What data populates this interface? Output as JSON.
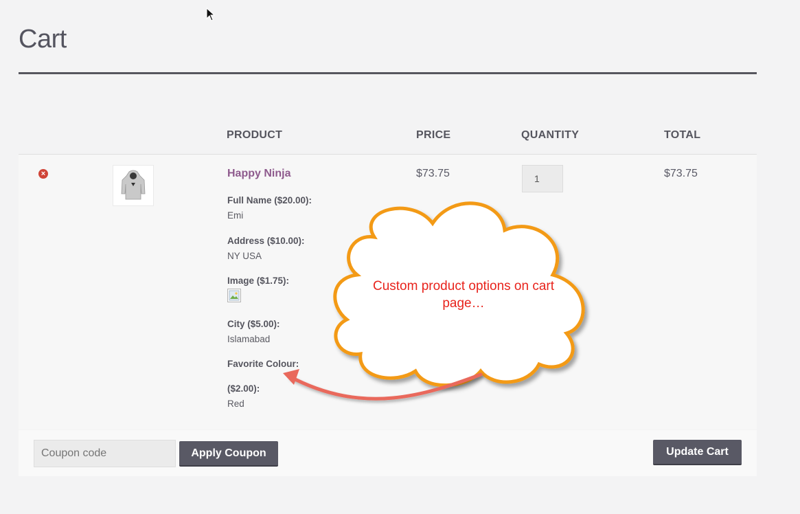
{
  "page": {
    "title": "Cart"
  },
  "table": {
    "headers": {
      "product": "PRODUCT",
      "price": "PRICE",
      "quantity": "QUANTITY",
      "total": "TOTAL"
    }
  },
  "cart_item": {
    "remove_icon": "remove-x-icon",
    "thumbnail_icon": "hoodie-icon",
    "name": "Happy Ninja",
    "price": "$73.75",
    "quantity": "1",
    "total": "$73.75",
    "options": [
      {
        "label": "Full Name ($20.00):",
        "value": "Emi"
      },
      {
        "label": "Address ($10.00):",
        "value": "NY USA"
      },
      {
        "label": "Image ($1.75):",
        "value": ""
      },
      {
        "label": "City ($5.00):",
        "value": "Islamabad"
      },
      {
        "label_line1": "Favorite Colour:",
        "label_line2": "($2.00):",
        "value": "Red"
      }
    ]
  },
  "actions": {
    "coupon_placeholder": "Coupon code",
    "apply_coupon_label": "Apply Coupon",
    "update_cart_label": "Update Cart"
  },
  "annotation": {
    "text": "Custom product options on cart page…"
  },
  "colors": {
    "product_link": "#8e5a8d",
    "button": "#595965",
    "remove_icon": "#d04437",
    "callout_outline": "#f39a12",
    "callout_text": "#e8231c",
    "arrow": "#e9695c"
  }
}
